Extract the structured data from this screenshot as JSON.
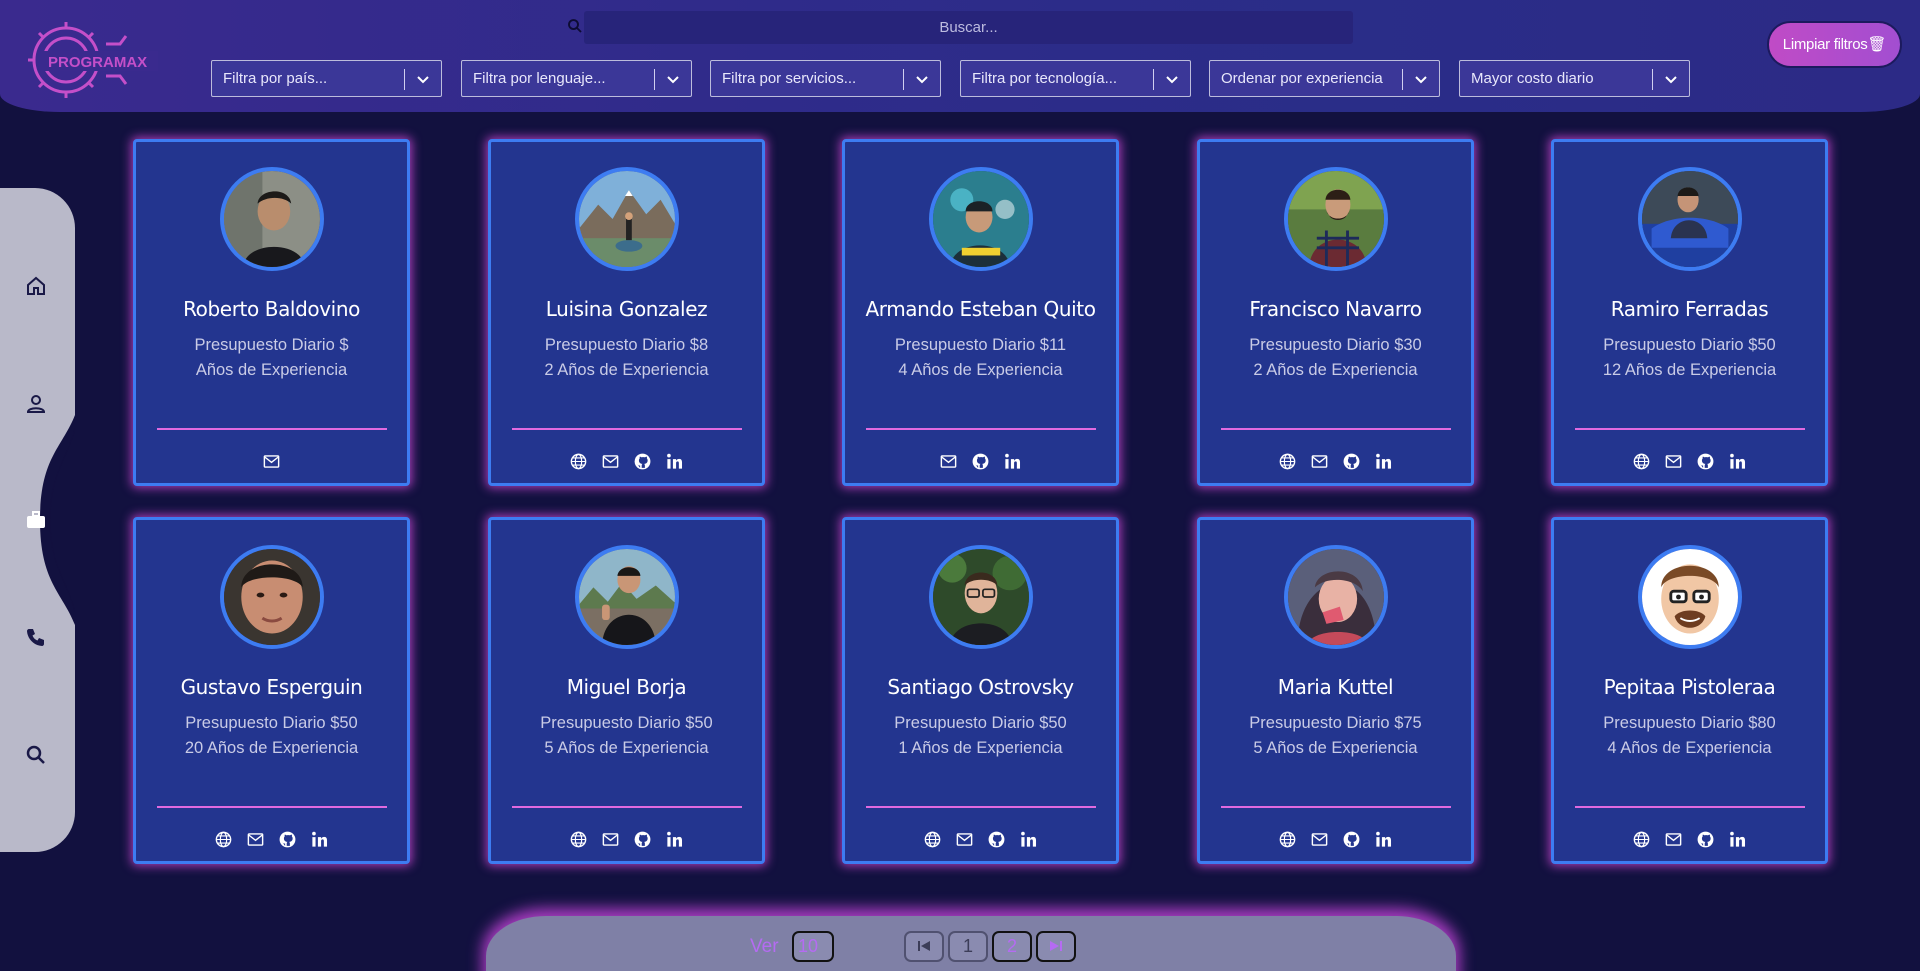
{
  "header": {
    "logo_text": "PROGRAMAX",
    "search_placeholder": "Buscar...",
    "clear_filters_label": "Limpiar filtros🗑",
    "filters": [
      {
        "label": "Filtra por país..."
      },
      {
        "label": "Filtra por lenguaje..."
      },
      {
        "label": "Filtra por servicios..."
      },
      {
        "label": "Filtra por tecnología..."
      },
      {
        "label": "Ordenar por experiencia"
      },
      {
        "label": "Mayor costo diario"
      }
    ]
  },
  "sidebar": {
    "items": [
      {
        "icon": "home-icon"
      },
      {
        "icon": "person-icon"
      },
      {
        "icon": "briefcase-icon",
        "active": true
      },
      {
        "icon": "phone-icon"
      },
      {
        "icon": "search-icon"
      }
    ]
  },
  "cards": [
    {
      "name": "Roberto Baldovino",
      "budget": "Presupuesto Diario $",
      "experience": "Años de Experiencia",
      "links": [
        "mail"
      ]
    },
    {
      "name": "Luisina Gonzalez",
      "budget": "Presupuesto Diario $8",
      "experience": "2 Años de Experiencia",
      "links": [
        "web",
        "mail",
        "github",
        "linkedin"
      ]
    },
    {
      "name": "Armando Esteban Quito",
      "budget": "Presupuesto Diario $11",
      "experience": "4 Años de Experiencia",
      "links": [
        "mail",
        "github",
        "linkedin"
      ]
    },
    {
      "name": "Francisco Navarro",
      "budget": "Presupuesto Diario $30",
      "experience": "2 Años de Experiencia",
      "links": [
        "web",
        "mail",
        "github",
        "linkedin"
      ]
    },
    {
      "name": "Ramiro Ferradas",
      "budget": "Presupuesto Diario $50",
      "experience": "12 Años de Experiencia",
      "links": [
        "web",
        "mail",
        "github",
        "linkedin"
      ]
    },
    {
      "name": "Gustavo Esperguin",
      "budget": "Presupuesto Diario $50",
      "experience": "20 Años de Experiencia",
      "links": [
        "web",
        "mail",
        "github",
        "linkedin"
      ]
    },
    {
      "name": "Miguel Borja",
      "budget": "Presupuesto Diario $50",
      "experience": "5 Años de Experiencia",
      "links": [
        "web",
        "mail",
        "github",
        "linkedin"
      ]
    },
    {
      "name": "Santiago Ostrovsky",
      "budget": "Presupuesto Diario $50",
      "experience": "1 Años de Experiencia",
      "links": [
        "web",
        "mail",
        "github",
        "linkedin"
      ]
    },
    {
      "name": "Maria Kuttel",
      "budget": "Presupuesto Diario $75",
      "experience": "5 Años de Experiencia",
      "links": [
        "web",
        "mail",
        "github",
        "linkedin"
      ]
    },
    {
      "name": "Pepitaa Pistoleraa",
      "budget": "Presupuesto Diario $80",
      "experience": "4 Años de Experiencia",
      "links": [
        "web",
        "mail",
        "github",
        "linkedin"
      ]
    }
  ],
  "pagination": {
    "per_page_label": "Ver",
    "per_page_value": "10",
    "pages": [
      "1",
      "2"
    ],
    "current_page": "2"
  },
  "colors": {
    "background": "#12113f",
    "card": "#23358f",
    "card_border": "#3d7cf2",
    "glow": "#d64cdc",
    "accent": "#b56bf2"
  }
}
